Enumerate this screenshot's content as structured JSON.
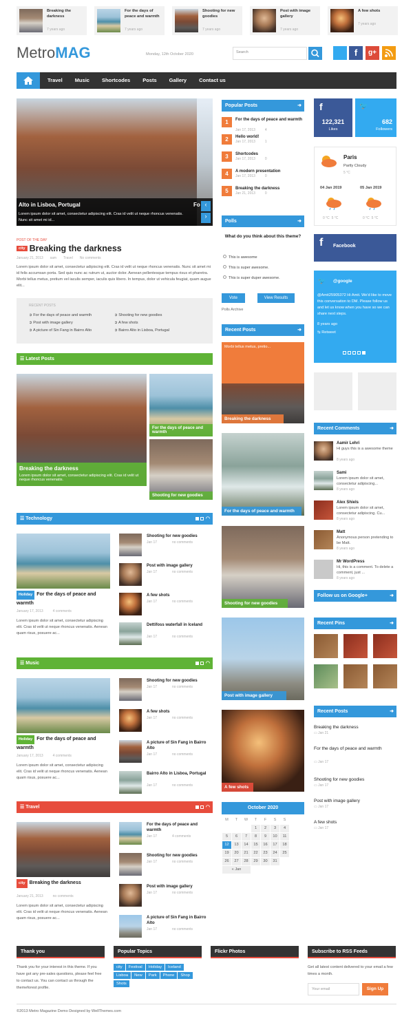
{
  "top_strip": [
    {
      "title": "Breaking the darkness",
      "time": "7 years ago"
    },
    {
      "title": "For the days of peace and warmth",
      "time": "7 years ago"
    },
    {
      "title": "Shooting for new goodies",
      "time": "7 years ago"
    },
    {
      "title": "Post with image gallery",
      "time": "7 years ago"
    },
    {
      "title": "A few shots",
      "time": "7 years ago"
    }
  ],
  "header": {
    "logo_a": "Metro",
    "logo_b": "MAG",
    "date": "Monday, 12th October 2020",
    "search_placeholder": "Search"
  },
  "nav": [
    "Travel",
    "Music",
    "Shortcodes",
    "Posts",
    "Gallery",
    "Contact us"
  ],
  "slider": {
    "caption": "Alto in Lisboa, Portugal",
    "text": "Lorem ipsum dolor sit amet, consectetur adipiscing elit. Cras id velit ut neque rhoncus venenatis. Nunc sit amet mi id...",
    "next_caption": "Fo"
  },
  "potd": {
    "label": "POST OF THE DAY",
    "tag": "city",
    "title": "Breaking the darkness",
    "date": "January 21, 2013",
    "author": "sam",
    "category": "Travel",
    "comments": "No comments",
    "text": "Lorem ipsum dolor sit amet, consectetur adipiscing elit. Cras id velit ut neque rhoncus venenatis. Nunc sit amet mi id felis accumsan porta. Sed quis nunc ac rutrum ut, auctor dolor. Aenean pellentesque tempus risus et pharetra. Morbi tellus metus, pretium vel iaculis semper, iaculis quis libero. In tempus, dolor ut vehicula feugiat, quam augue elit...",
    "recent_label": "RECENT POSTS",
    "recent": [
      "For the days of peace and warmth",
      "Shooting for new goodies",
      "Post with image gallery",
      "A few shots",
      "A picture of Sin Fang in Bairro Alto",
      "Bairro Alto in Lisboa, Portugal"
    ]
  },
  "latest": {
    "header": "Latest Posts",
    "main_title": "Breaking the darkness",
    "main_text": "Lorem ipsum dolor sit amet, consectetur adipiscing elit. Cras id velit ut neque rhoncus venenatis.",
    "side1": "For the days of peace and warmth",
    "side2": "Shooting for new goodies"
  },
  "technology": {
    "header": "Technology",
    "tag": "Holiday",
    "title": "For the days of peace and warmth",
    "date": "January 17, 2013",
    "comments": "4 comments",
    "text": "Lorem ipsum dolor sit amet, consectetur adipiscing elit. Cras id velit ut neque rhoncus venenatis. Aenean quam risus, posuere ac...",
    "list": [
      {
        "t": "Shooting for new goodies",
        "d": "Jan 17",
        "c": "no comments"
      },
      {
        "t": "Post with image gallery",
        "d": "Jan 17",
        "c": "no comments"
      },
      {
        "t": "A few shots",
        "d": "Jan 17",
        "c": "no comments"
      },
      {
        "t": "Dettifoss waterfall in Iceland",
        "d": "Jan 17",
        "c": "no comments"
      }
    ]
  },
  "music": {
    "header": "Music",
    "tag": "Holiday",
    "title": "For the days of peace and warmth",
    "date": "January 17, 2013",
    "comments": "4 comments",
    "text": "Lorem ipsum dolor sit amet, consectetur adipiscing elit. Cras id velit ut neque rhoncus venenatis. Aenean quam risus, posuere ac...",
    "list": [
      {
        "t": "Shooting for new goodies",
        "d": "Jan 17",
        "c": "no comments"
      },
      {
        "t": "A few shots",
        "d": "Jan 17",
        "c": "no comments"
      },
      {
        "t": "A picture of Sin Fang in Bairro Alto",
        "d": "Jan 17",
        "c": "no comments"
      },
      {
        "t": "Bairro Alto in Lisboa, Portugal",
        "d": "Jan 17",
        "c": "no comments"
      }
    ]
  },
  "travel": {
    "header": "Travel",
    "tag": "city",
    "title": "Breaking the darkness",
    "date": "January 21, 2013",
    "comments": "no comments",
    "text": "Lorem ipsum dolor sit amet, consectetur adipiscing elit. Cras id velit ut neque rhoncus venenatis. Aenean quam risus, posuere ac...",
    "list": [
      {
        "t": "For the days of peace and warmth",
        "d": "Jan 17",
        "c": "4 comments"
      },
      {
        "t": "Shooting for new goodies",
        "d": "Jan 17",
        "c": "no comments"
      },
      {
        "t": "Post with image gallery",
        "d": "Jan 17",
        "c": "no comments"
      },
      {
        "t": "A picture of Sin Fang in Bairro Alto",
        "d": "Jan 17",
        "c": "no comments"
      }
    ]
  },
  "popular": {
    "header": "Popular Posts",
    "items": [
      {
        "t": "For the days of peace and warmth",
        "d": "Jan 17, 2013",
        "c": "4"
      },
      {
        "t": "Hello world!",
        "d": "Jan 17, 2013",
        "c": "1"
      },
      {
        "t": "Shortcodes",
        "d": "Jan 17, 2013",
        "c": "0"
      },
      {
        "t": "A modern presentation",
        "d": "Jan 17, 2013",
        "c": "0"
      },
      {
        "t": "Breaking the darkness",
        "d": "Jan 21, 2013",
        "c": "0"
      }
    ]
  },
  "polls": {
    "header": "Polls",
    "question": "What do you think about this theme?",
    "options": [
      "This is awesome",
      "This is super awesome.",
      "This is super duper awesome."
    ],
    "vote": "Vote",
    "results": "View Results",
    "archive": "Polls Archive"
  },
  "recent_posts_mid": {
    "header": "Recent Posts",
    "orange_text": "Morbi tellus metus, pretio...",
    "items": [
      "Breaking the darkness",
      "For the days of peace and warmth",
      "Shooting for new goodies",
      "Post with image gallery",
      "A few shots"
    ]
  },
  "calendar": {
    "header": "October 2020",
    "days": [
      "M",
      "T",
      "W",
      "T",
      "F",
      "S",
      "S"
    ],
    "rows": [
      [
        "",
        "",
        "",
        "1",
        "2",
        "3",
        "4"
      ],
      [
        "5",
        "6",
        "7",
        "8",
        "9",
        "10",
        "11"
      ],
      [
        "12",
        "13",
        "14",
        "15",
        "16",
        "17",
        "18"
      ],
      [
        "19",
        "20",
        "21",
        "22",
        "23",
        "24",
        "25"
      ],
      [
        "26",
        "27",
        "28",
        "29",
        "30",
        "31",
        ""
      ]
    ],
    "prev": "« Jan"
  },
  "social": {
    "fb_count": "122,321",
    "fb_label": "Likes",
    "tw_count": "682",
    "tw_label": "Followers"
  },
  "weather": {
    "city": "Paris",
    "cond": "Partly Cloudy",
    "temp": "5 °C",
    "d1": "04 Jan 2019",
    "d2": "05 Jan 2019",
    "t1a": "0 °C",
    "t1b": "5 °C",
    "t2a": "0 °C",
    "t2b": "5 °C"
  },
  "facebook_box": "Facebook",
  "twitter_box": {
    "handle": "@google",
    "text": "@Amit25905372 Hi Amit. We'd like to move this conversation to DM. Please follow us and let us know when you have so we can share next steps.",
    "time": "8 years ago",
    "retweet": "Retweet"
  },
  "recent_comments": {
    "header": "Recent Comments",
    "items": [
      {
        "n": "Aamir Lehri",
        "t": "Hi guys this is a awesome theme",
        "time": "8 years ago"
      },
      {
        "n": "Sami",
        "t": "Lorem ipsum dolor sit amet, consectetur adipiscing...",
        "time": "8 years ago"
      },
      {
        "n": "Alex Shiels",
        "t": "Lorem ipsum dolor sit amet, consectetur adipiscing. Cu...",
        "time": "8 years ago"
      },
      {
        "n": "Matt",
        "t": "Anonymous person pretending to be Matt.",
        "time": "8 years ago"
      },
      {
        "n": "Mr WordPress",
        "t": "Hi, this is a comment. To delete a comment, just ...",
        "time": "8 years ago"
      }
    ]
  },
  "google_plus": "Follow us on Google+",
  "recent_pins": "Recent Pins",
  "recent_posts_right": {
    "header": "Recent Posts",
    "items": [
      {
        "t": "Breaking the darkness",
        "d": "Jan 21"
      },
      {
        "t": "For the days of peace and warmth",
        "d": "Jan 17"
      },
      {
        "t": "Shooting for new goodies",
        "d": "Jan 17"
      },
      {
        "t": "Post with image gallery",
        "d": "Jan 17"
      },
      {
        "t": "A few shots",
        "d": "Jan 17"
      }
    ]
  },
  "footer": {
    "thanks_h": "Thank you",
    "thanks_t": "Thank you for your interest in this theme. If you have got any pre-sales questions, please feel free to contact us. You can contact us through the themeforest profile.",
    "topics_h": "Popular Topics",
    "topics": [
      "city",
      "Festival",
      "Holiday",
      "Iceland",
      "Lisboa",
      "New",
      "Park",
      "Phone",
      "Shop",
      "Shots"
    ],
    "flickr_h": "Flickr Photos",
    "rss_h": "Subscribe to RSS Feeds",
    "rss_t": "Get all latest content delivered to your email a few times a month.",
    "email_placeholder": "Your email",
    "signup": "Sign Up",
    "copyright": "©2013 Metro Magazine Demo Designed by WellThemes.com"
  },
  "colors": {
    "blue": "#3498db",
    "green": "#5fb336",
    "red": "#e74c3c",
    "orange": "#f07c3b",
    "dark": "#333333",
    "fb": "#3b5998",
    "tw": "#33aaf0"
  }
}
